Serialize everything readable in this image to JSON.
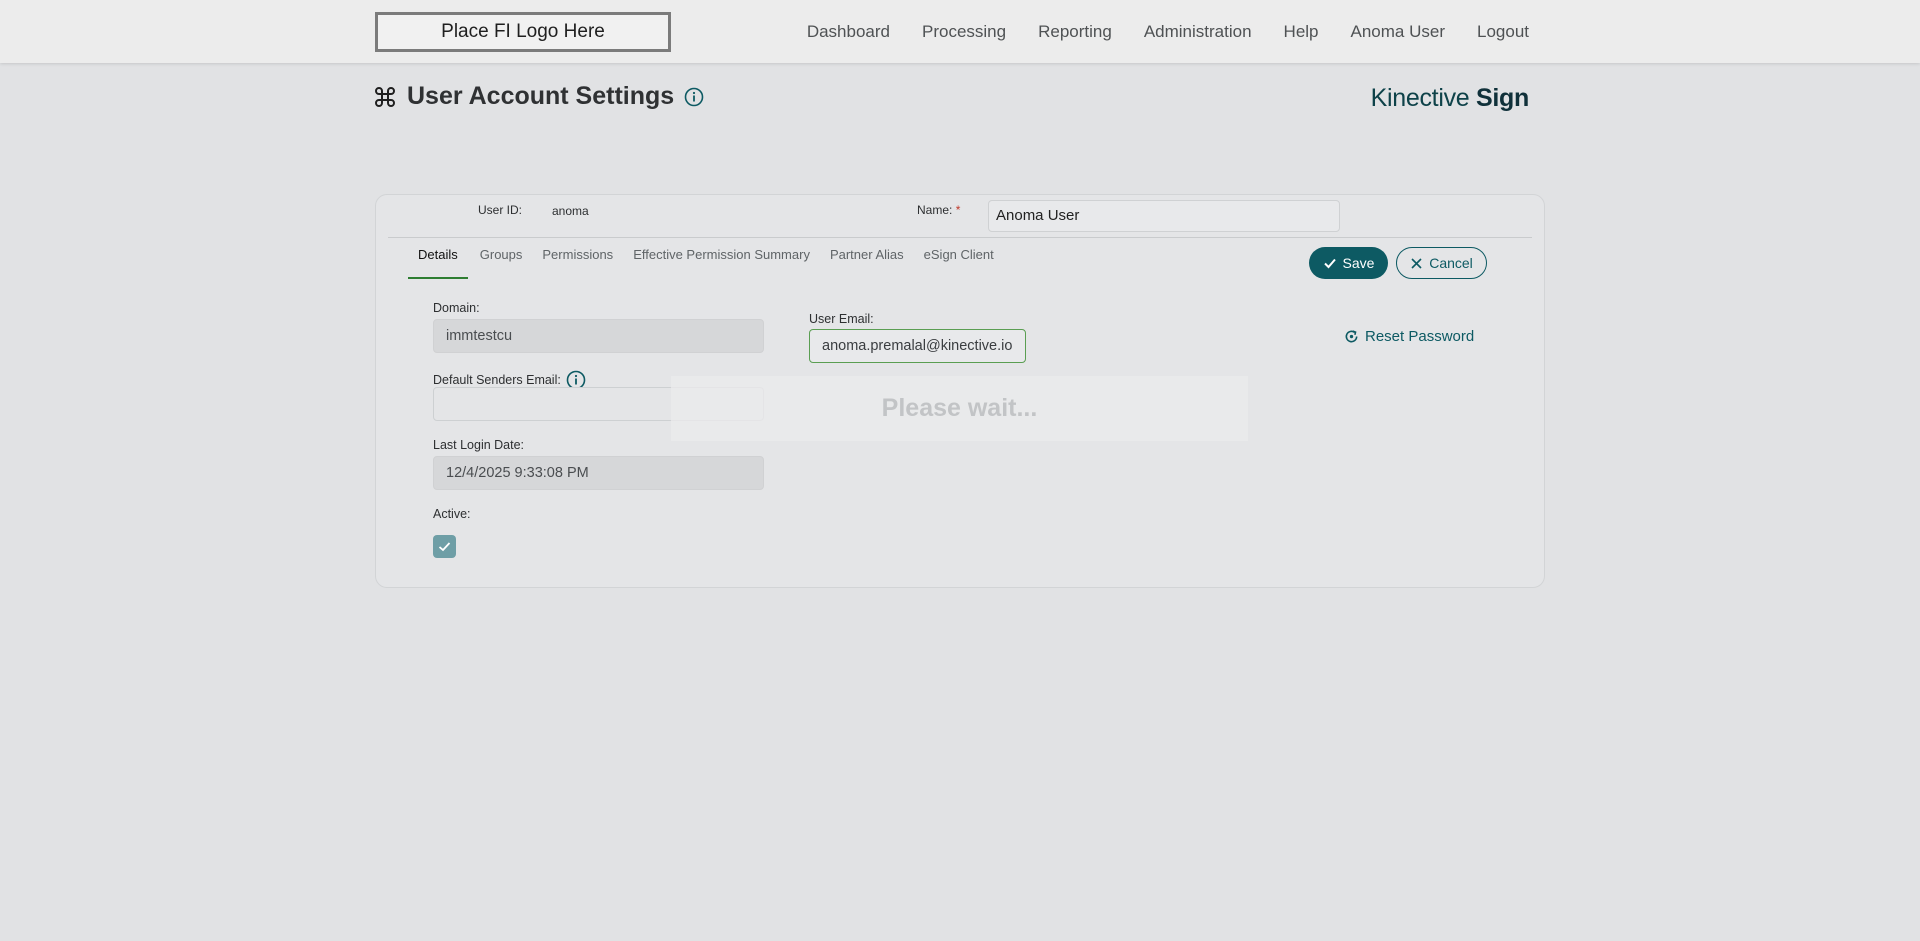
{
  "topbar": {
    "logo_text": "Place FI Logo Here",
    "nav": [
      "Dashboard",
      "Processing",
      "Reporting",
      "Administration",
      "Help",
      "Anoma User",
      "Logout"
    ]
  },
  "header": {
    "title": "User Account Settings",
    "brand_light": "Kinective ",
    "brand_bold": "Sign"
  },
  "account": {
    "user_id_label": "User ID:",
    "user_id": "anoma",
    "name_label": "Name:",
    "required_mark": "*",
    "name_value": "Anoma User"
  },
  "tabs": [
    "Details",
    "Groups",
    "Permissions",
    "Effective Permission Summary",
    "Partner Alias",
    "eSign Client"
  ],
  "active_tab": "Details",
  "actions": {
    "save": "Save",
    "cancel": "Cancel",
    "reset_password": "Reset Password"
  },
  "details": {
    "domain_label": "Domain:",
    "domain_value": "immtestcu",
    "default_senders_email_label": "Default Senders Email:",
    "default_senders_email_value": "",
    "last_login_label": "Last Login Date:",
    "last_login_value": "12/4/2025 9:33:08 PM",
    "active_label": "Active:",
    "active_checked": true,
    "user_email_label": "User Email:",
    "user_email_value": "anoma.premalal@kinective.io"
  },
  "overlay": {
    "message": "Please wait..."
  },
  "colors": {
    "accent": "#0d5a63",
    "tab_underline": "#2e7d32",
    "email_border": "#5a9e52"
  }
}
